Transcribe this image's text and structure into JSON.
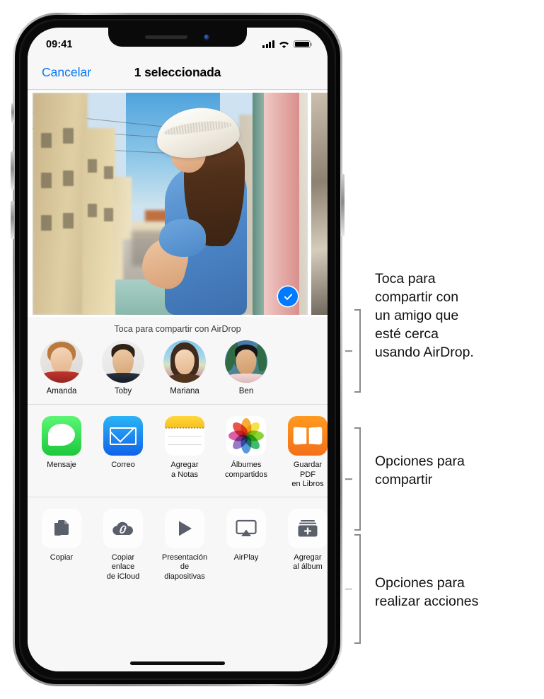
{
  "status_bar": {
    "time": "09:41",
    "cellular_icon": "signal-bars-icon",
    "wifi_icon": "wifi-icon",
    "battery_icon": "battery-full-icon"
  },
  "nav_bar": {
    "cancel_label": "Cancelar",
    "title": "1 seleccionada"
  },
  "photo": {
    "selected": true,
    "check_icon": "checkmark-icon",
    "accent_color": "#007aff",
    "description": "Mujer con sombrero blanco y vestido azul en un balcón sobre una calle europea"
  },
  "airdrop": {
    "hint": "Toca para compartir con AirDrop",
    "contacts": [
      {
        "name": "Amanda"
      },
      {
        "name": "Toby"
      },
      {
        "name": "Mariana"
      },
      {
        "name": "Ben"
      }
    ]
  },
  "share_apps": [
    {
      "label": "Mensaje",
      "icon": "messages-icon"
    },
    {
      "label": "Correo",
      "icon": "mail-icon"
    },
    {
      "label": "Agregar\na Notas",
      "icon": "notes-icon"
    },
    {
      "label": "Álbumes\ncompartidos",
      "icon": "photos-icon"
    },
    {
      "label": "Guardar PDF\nen Libros",
      "icon": "books-icon"
    }
  ],
  "actions": [
    {
      "label": "Copiar",
      "icon": "copy-icon"
    },
    {
      "label": "Copiar enlace\nde iCloud",
      "icon": "icloud-link-icon"
    },
    {
      "label": "Presentación\nde diapositivas",
      "icon": "play-icon"
    },
    {
      "label": "AirPlay",
      "icon": "airplay-icon"
    },
    {
      "label": "Agregar\nal álbum",
      "icon": "add-to-album-icon"
    }
  ],
  "callouts": {
    "airdrop": "Toca para\ncompartir con\nun amigo que\nesté cerca\nusando AirDrop.",
    "share": "Opciones para\ncompartir",
    "actions": "Opciones para\nrealizar acciones"
  }
}
